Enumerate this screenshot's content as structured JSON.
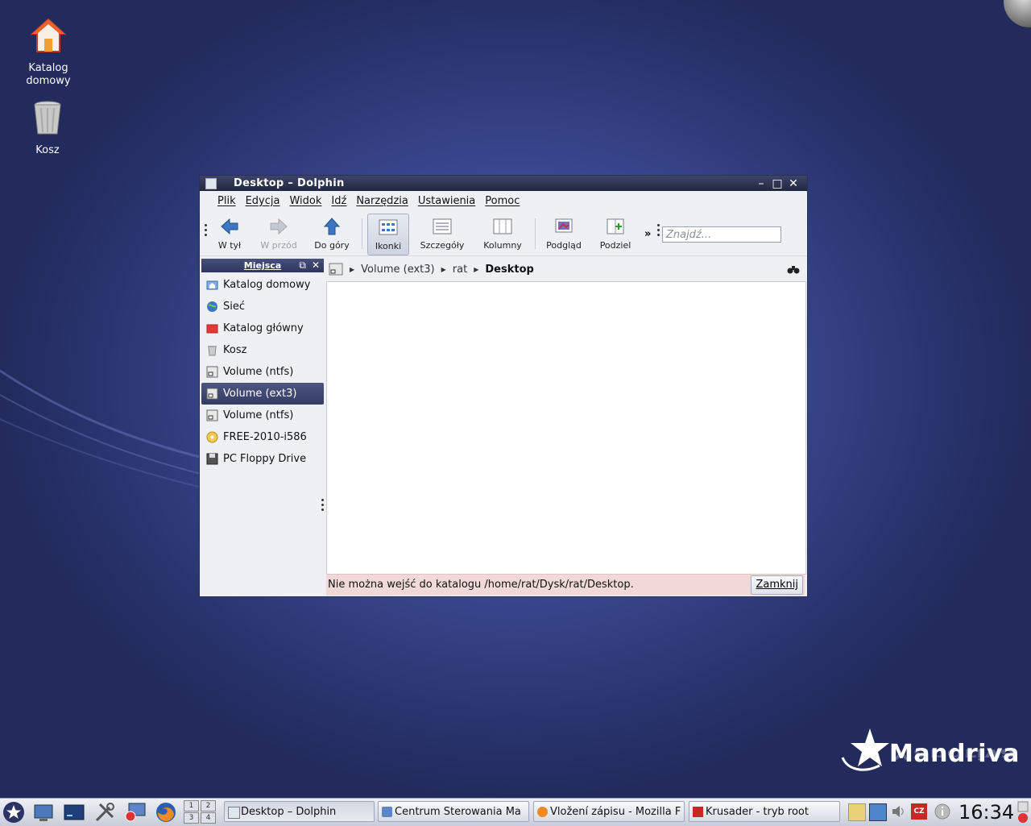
{
  "desktop": {
    "icons": [
      {
        "label_line1": "Katalog",
        "label_line2": "domowy"
      },
      {
        "label_line1": "Kosz",
        "label_line2": ""
      }
    ],
    "logo_text": "Mandriva"
  },
  "window": {
    "title": "Desktop – Dolphin",
    "menu": [
      "Plik",
      "Edycja",
      "Widok",
      "Idź",
      "Narzędzia",
      "Ustawienia",
      "Pomoc"
    ],
    "toolbar": {
      "back": "W tył",
      "forward": "W przód",
      "up": "Do góry",
      "icons": "Ikonki",
      "details": "Szczegóły",
      "columns": "Kolumny",
      "preview": "Podgląd",
      "split": "Podziel",
      "overflow": "»",
      "search_placeholder": "Znajdź..."
    },
    "sidebar": {
      "title": "Miejsca",
      "items": [
        {
          "label": "Katalog domowy",
          "icon": "home-folder-icon",
          "selected": false
        },
        {
          "label": "Sieć",
          "icon": "network-globe-icon",
          "selected": false
        },
        {
          "label": "Katalog główny",
          "icon": "root-folder-icon",
          "selected": false
        },
        {
          "label": "Kosz",
          "icon": "trash-icon",
          "selected": false
        },
        {
          "label": "Volume (ntfs)",
          "icon": "drive-icon",
          "selected": false
        },
        {
          "label": "Volume (ext3)",
          "icon": "drive-icon",
          "selected": true
        },
        {
          "label": "Volume (ntfs)",
          "icon": "drive-icon",
          "selected": false
        },
        {
          "label": "FREE-2010-i586",
          "icon": "optical-disc-icon",
          "selected": false
        },
        {
          "label": "PC Floppy Drive",
          "icon": "floppy-icon",
          "selected": false
        }
      ]
    },
    "breadcrumb": {
      "items": [
        "Volume (ext3)",
        "rat"
      ],
      "current": "Desktop"
    },
    "status": {
      "message": "Nie można wejść do katalogu /home/rat/Dysk/rat/Desktop.",
      "close_label": "Zamknij"
    }
  },
  "taskbar": {
    "tasks": [
      {
        "label": "Desktop – Dolphin",
        "active": true
      },
      {
        "label": "Centrum Sterowania Ma",
        "active": false
      },
      {
        "label": "Vložení zápisu - Mozilla F",
        "active": false
      },
      {
        "label": "Krusader - tryb root",
        "active": false
      }
    ],
    "pager": [
      "1",
      "2",
      "3",
      "4"
    ],
    "clock": "16:34",
    "keyboard_layout": "CZ"
  },
  "colors": {
    "accent": "#3b4270",
    "desktop_bg": "#3d4a93",
    "error_bg": "#f1d9d9"
  }
}
